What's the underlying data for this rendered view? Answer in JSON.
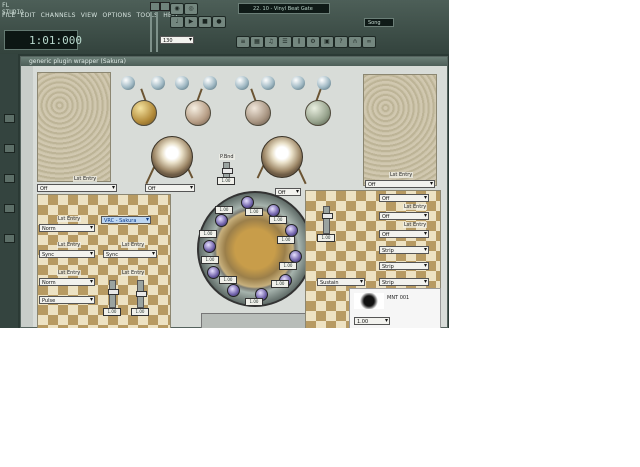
{
  "app": {
    "logo": "FL STUDIO",
    "menu": [
      "FILE",
      "EDIT",
      "CHANNELS",
      "VIEW",
      "OPTIONS",
      "TOOLS",
      "HELP"
    ],
    "time": "1:01:000",
    "song": "22. 10 - Vinyl Beat Gate",
    "pattern": "Song",
    "tempo": "130",
    "plugin_title": "generic plugin wrapper (Sakura)"
  },
  "panels": {
    "left_top_label": "Lst Entry",
    "left_top_select": "Off",
    "mid_select": "Off",
    "pitch_label": "P.Bnd",
    "pitch_value": "1.00",
    "mid_right_select": "Off",
    "right_top_label": "Lst Entry",
    "right_top_select": "Off"
  },
  "left_lower": {
    "lst_entry_1": "Lst Entry",
    "select_1": "Norm",
    "blue_select": "VRC - Sakura",
    "lst_entry_2": "Lst Entry",
    "select_2": "Sync",
    "lst_entry_3": "Lst Entry",
    "select_3": "Sync",
    "lst_entry_4": "Lst Entry",
    "lst_entry_5": "Lst Entry",
    "select_4": "Norm",
    "select_5": "Pulse",
    "fader_1_value": "1.00",
    "fader_2_value": "1.00"
  },
  "right_lower": {
    "select_1": "Off",
    "lst_entry_1": "Lst Entry",
    "select_2": "Off",
    "lst_entry_2": "Lst Entry",
    "select_3": "Off",
    "select_4": "Strip",
    "select_5": "Strip",
    "select_6": "Strip",
    "select_7": "Sustain",
    "fader_value": "1.00",
    "logo_text": "MNT 001",
    "logo_value": "1.00"
  },
  "wheel": {
    "knob_values": [
      "1.00",
      "1.00",
      "1.00",
      "1.00",
      "1.00",
      "1.00",
      "1.00",
      "1.00",
      "1.00",
      "1.00"
    ]
  }
}
